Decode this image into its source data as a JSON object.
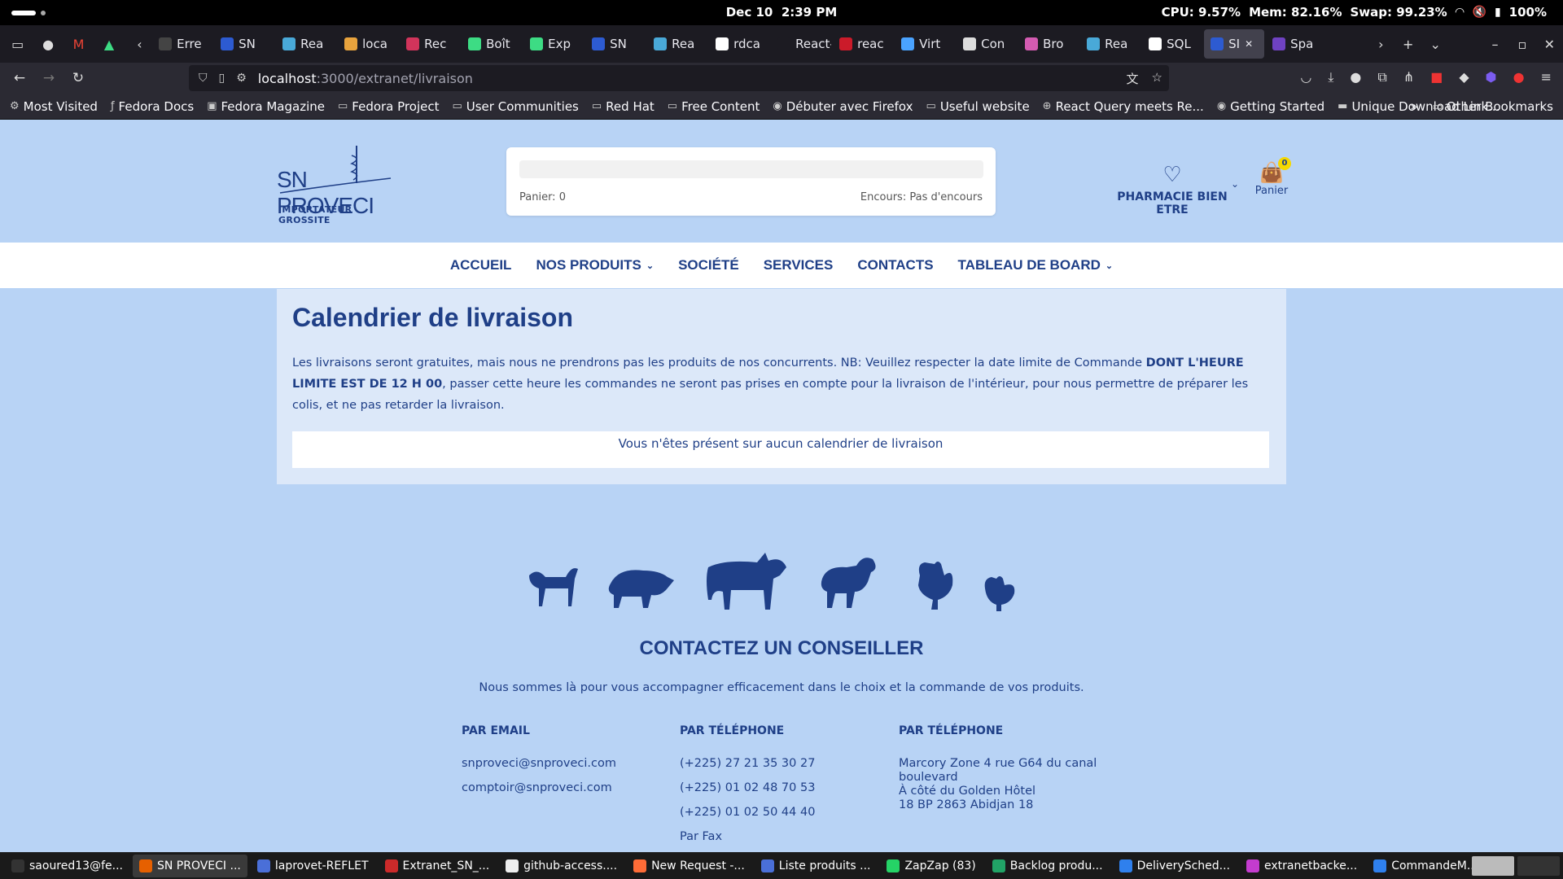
{
  "system": {
    "date": "Dec 10",
    "time": "2:39 PM",
    "cpu": "CPU: 9.57%",
    "mem": "Mem: 82.16%",
    "swap": "Swap: 99.23%",
    "battery": "100%"
  },
  "tabs": [
    {
      "label": "Erre",
      "color": "#444"
    },
    {
      "label": "SN",
      "color": "#2d5bd1"
    },
    {
      "label": "Rea",
      "color": "#49a9d8"
    },
    {
      "label": "loca",
      "color": "#e8a33d"
    },
    {
      "label": "Rec",
      "color": "#d1345b"
    },
    {
      "label": "Boît",
      "color": "#3ddc84"
    },
    {
      "label": "Exp",
      "color": "#3ddc84"
    },
    {
      "label": "SN",
      "color": "#2d5bd1"
    },
    {
      "label": "Rea",
      "color": "#49a9d8"
    },
    {
      "label": "rdca",
      "color": "#fff"
    },
    {
      "label": "React-",
      "color": "#1c1b22"
    },
    {
      "label": "reac",
      "color": "#cb1b2a"
    },
    {
      "label": "Virt",
      "color": "#4aa3ff"
    },
    {
      "label": "Con",
      "color": "#ddd"
    },
    {
      "label": "Bro",
      "color": "#d35bb1"
    },
    {
      "label": "Rea",
      "color": "#49a9d8"
    },
    {
      "label": "SQL",
      "color": "#fff"
    },
    {
      "label": "SI",
      "color": "#2d5bd1",
      "active": true
    },
    {
      "label": "Spa",
      "color": "#6f42c1"
    }
  ],
  "url": {
    "host": "localhost",
    "path": ":3000/extranet/livraison"
  },
  "bookmarks": [
    {
      "label": "Most Visited",
      "icon": "gear-icon"
    },
    {
      "label": "Fedora Docs",
      "icon": "fedora-icon"
    },
    {
      "label": "Fedora Magazine",
      "icon": "fm-icon"
    },
    {
      "label": "Fedora Project",
      "icon": "folder-icon"
    },
    {
      "label": "User Communities",
      "icon": "folder-icon"
    },
    {
      "label": "Red Hat",
      "icon": "folder-icon"
    },
    {
      "label": "Free Content",
      "icon": "folder-icon"
    },
    {
      "label": "Débuter avec Firefox",
      "icon": "firefox-icon"
    },
    {
      "label": "Useful website",
      "icon": "folder-icon"
    },
    {
      "label": "React Query meets Re...",
      "icon": "globe-icon"
    },
    {
      "label": "Getting Started",
      "icon": "firefox-icon"
    },
    {
      "label": "Unique Download Link...",
      "icon": "wt-icon"
    }
  ],
  "other_bookmarks": "Other Bookmarks",
  "site": {
    "brand": "SN PROVECI",
    "tagline": "IMPORTATEUR GROSSITE",
    "cart_line": "Panier: 0",
    "encours": "Encours: Pas d'encours",
    "account": "PHARMACIE BIEN ETRE",
    "panier_label": "Panier",
    "panier_count": "0"
  },
  "menu": [
    {
      "label": "ACCUEIL",
      "dropdown": false
    },
    {
      "label": "NOS PRODUITS",
      "dropdown": true
    },
    {
      "label": "SOCIÉTÉ",
      "dropdown": false
    },
    {
      "label": "SERVICES",
      "dropdown": false
    },
    {
      "label": "CONTACTS",
      "dropdown": false
    },
    {
      "label": "TABLEAU DE BOARD",
      "dropdown": true
    }
  ],
  "main": {
    "title": "Calendrier de livraison",
    "desc_part1": "Les livraisons seront gratuites, mais nous ne prendrons pas les produits de nos concurrents. NB: Veuillez respecter la date limite de Commande ",
    "desc_bold": "DONT L'HEURE LIMITE EST DE 12 H 00",
    "desc_part2": ", passer cette heure les commandes ne seront pas prises en compte pour la livraison de l'intérieur, pour nous permettre de préparer les colis, et ne pas retarder la livraison.",
    "empty_message": "Vous n'êtes présent sur aucun calendrier de livraison"
  },
  "contact": {
    "title": "CONTACTEZ UN CONSEILLER",
    "subtitle": "Nous sommes là pour vous accompagner efficacement dans le choix et la commande de vos produits.",
    "email_heading": "PAR EMAIL",
    "emails": [
      "snproveci@snproveci.com",
      "comptoir@snproveci.com"
    ],
    "phone_heading": "PAR TÉLÉPHONE",
    "phones": [
      "(+225) 27 21 35 30 27",
      "(+225) 01 02 48 70 53",
      "(+225) 01 02 50 44 40",
      "Par Fax"
    ],
    "address_heading": "PAR TÉLÉPHONE",
    "address": [
      "Marcory Zone 4 rue G64 du canal",
      "boulevard",
      "À côté du Golden Hôtel",
      "18 BP 2863 Abidjan 18"
    ]
  },
  "taskbar": [
    {
      "label": "saoured13@fe...",
      "color": "#333"
    },
    {
      "label": "SN PROVECI ...",
      "color": "#e66000",
      "active": true
    },
    {
      "label": "laprovet-REFLET",
      "color": "#4a6fd8"
    },
    {
      "label": "Extranet_SN_...",
      "color": "#cc2a2a"
    },
    {
      "label": "github-access....",
      "color": "#eee"
    },
    {
      "label": "New Request -...",
      "color": "#ff6c37"
    },
    {
      "label": "Liste produits ...",
      "color": "#4a6fd8"
    },
    {
      "label": "ZapZap (83)",
      "color": "#25d366"
    },
    {
      "label": "Backlog produ...",
      "color": "#21a366"
    },
    {
      "label": "DeliverySched...",
      "color": "#2f80ed"
    },
    {
      "label": "extranetbacke...",
      "color": "#c43ccf"
    },
    {
      "label": "CommandeM...",
      "color": "#2f80ed"
    }
  ]
}
